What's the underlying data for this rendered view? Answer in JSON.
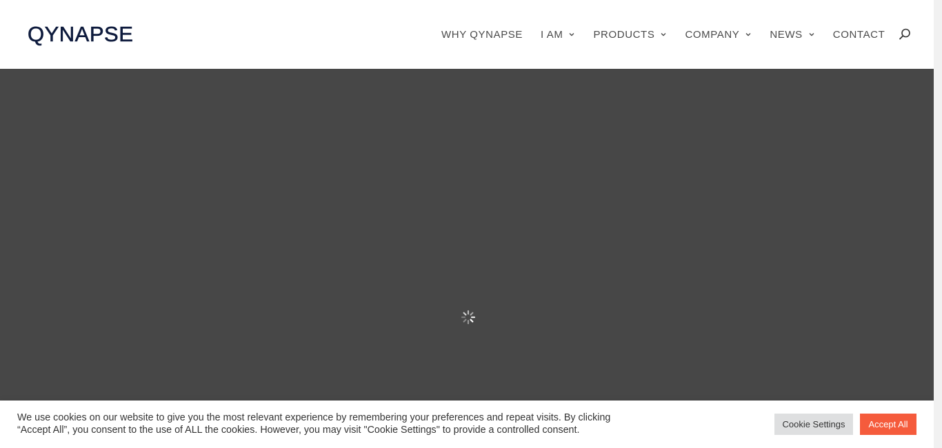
{
  "brand": {
    "logo_text": "QYNAPSE",
    "logo_color": "#0e1b3d"
  },
  "nav": {
    "items": [
      {
        "label": "WHY QYNAPSE",
        "has_dropdown": false
      },
      {
        "label": "I AM",
        "has_dropdown": true
      },
      {
        "label": "PRODUCTS",
        "has_dropdown": true
      },
      {
        "label": "COMPANY",
        "has_dropdown": true
      },
      {
        "label": "NEWS",
        "has_dropdown": true
      },
      {
        "label": "CONTACT",
        "has_dropdown": false
      }
    ],
    "search_icon": "search-icon",
    "dropdown_icon": "chevron-down-icon"
  },
  "hero": {
    "background_color": "#474747",
    "loading_icon": "loading-spinner-icon"
  },
  "cookie_banner": {
    "message": "We use cookies on our website to give you the most relevant experience by remembering your preferences and repeat visits. By clicking “Accept All”, you consent to the use of ALL the cookies. However, you may visit \"Cookie Settings\" to provide a controlled consent.",
    "settings_label": "Cookie Settings",
    "accept_label": "Accept All",
    "accept_color": "#f55b3c",
    "settings_color": "#dedfe0"
  }
}
